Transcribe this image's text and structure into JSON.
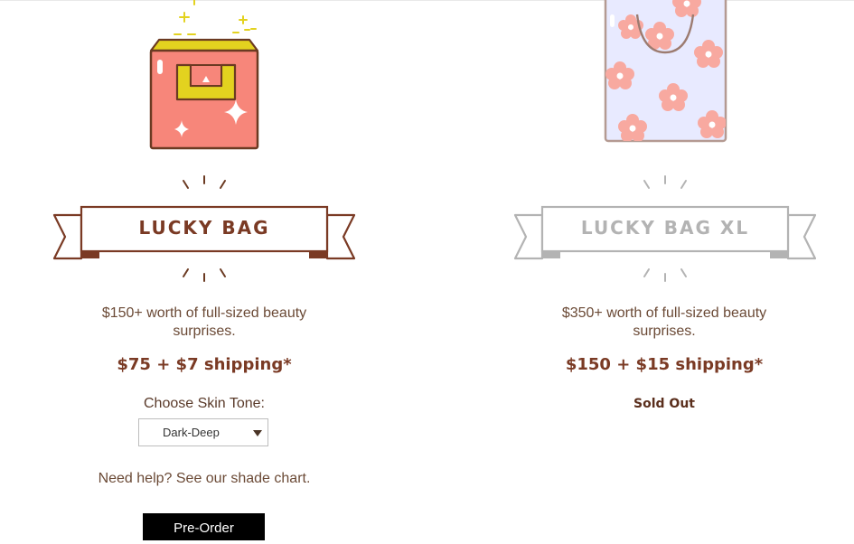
{
  "colors": {
    "brown": "#7a3a24",
    "gray": "#b3b3b3",
    "pink": "#f7867a",
    "yellow": "#e3d21f",
    "lavender": "#e8eaff",
    "flower": "#f8a9a0"
  },
  "products": [
    {
      "name": "LUCKY BAG",
      "description": "$150+ worth of full-sized beauty surprises.",
      "price": "$75 + $7 shipping*",
      "skin_label": "Choose Skin Tone:",
      "skin_selected": "Dark-Deep",
      "help_text": "Need help? See our shade chart.",
      "button_label": "Pre-Order",
      "icon": "gift-bag-icon"
    },
    {
      "name": "LUCKY BAG XL",
      "description": "$350+ worth of full-sized beauty surprises.",
      "price": "$150 + $15 shipping*",
      "status": "Sold Out",
      "icon": "flower-bag-icon"
    }
  ]
}
